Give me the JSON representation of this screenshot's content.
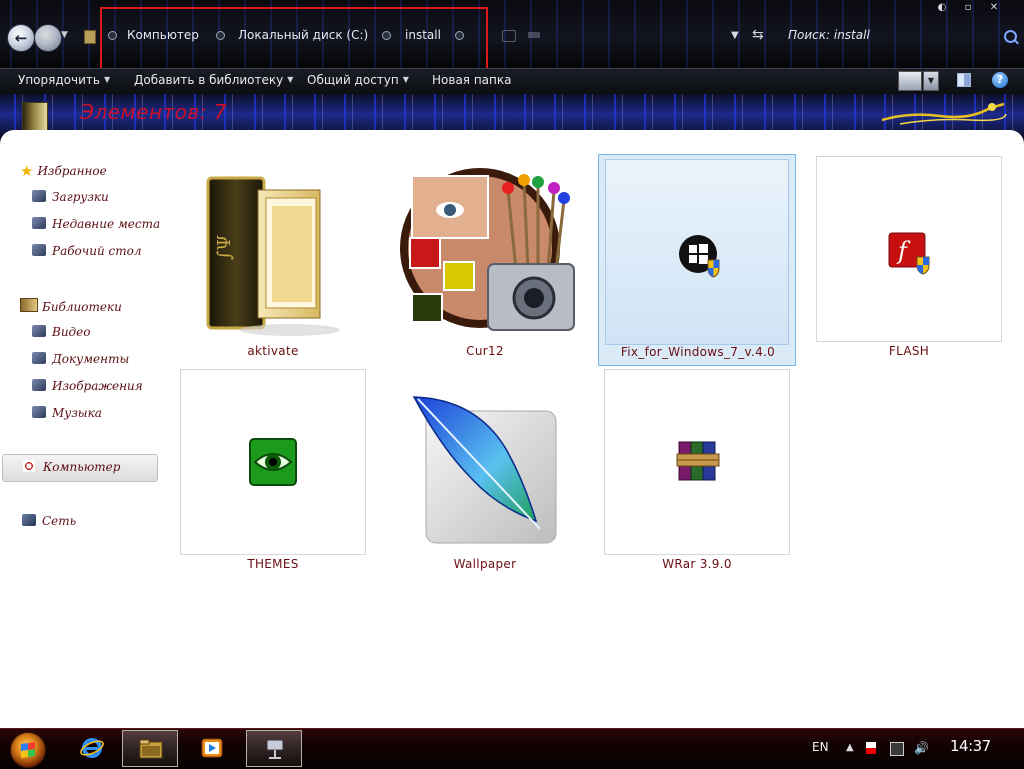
{
  "address_bar": {
    "breadcrumbs": [
      "Компьютер",
      "Локальный диск (C:)",
      "install"
    ],
    "search_placeholder": "Поиск: install"
  },
  "toolbar": {
    "organize": "Упорядочить",
    "add_to_library": "Добавить в библиотеку",
    "share": "Общий доступ",
    "new_folder": "Новая папка"
  },
  "details": {
    "items_count": "Элементов: 7"
  },
  "sidebar": {
    "favorites": {
      "title": "Избранное",
      "items": [
        "Загрузки",
        "Недавние места",
        "Рабочий стол"
      ]
    },
    "libraries": {
      "title": "Библиотеки",
      "items": [
        "Видео",
        "Документы",
        "Изображения",
        "Музыка"
      ]
    },
    "computer": "Компьютер",
    "network": "Сеть"
  },
  "files": [
    {
      "name": "aktivate",
      "icon": "book-folder-icon",
      "selected": false
    },
    {
      "name": "Cur12",
      "icon": "paint-camera-icon",
      "selected": false
    },
    {
      "name": "Fix_for_Windows_7_v.4.0",
      "icon": "windows-shield-icon",
      "selected": true
    },
    {
      "name": "FLASH",
      "icon": "flash-shield-icon",
      "selected": false
    },
    {
      "name": "THEMES",
      "icon": "eye-icon",
      "selected": false
    },
    {
      "name": "Wallpaper",
      "icon": "feather-icon",
      "selected": false
    },
    {
      "name": "WRar 3.9.0",
      "icon": "winrar-books-icon",
      "selected": false
    }
  ],
  "taskbar": {
    "language": "EN",
    "time": "14:37"
  },
  "colors": {
    "highlight_box": "#e01818",
    "label_text": "#6a0e14",
    "items_count": "#c8102a",
    "selection_bg": "#dbeaf7"
  }
}
